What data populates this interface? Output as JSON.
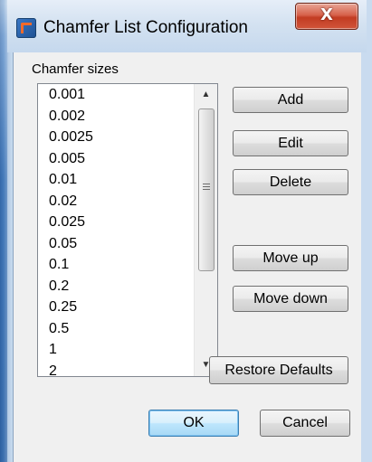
{
  "window": {
    "title": "Chamfer List Configuration",
    "close_glyph": "X"
  },
  "group": {
    "label": "Chamfer sizes"
  },
  "list": {
    "items": [
      "0.001",
      "0.002",
      "0.0025",
      "0.005",
      "0.01",
      "0.02",
      "0.025",
      "0.05",
      "0.1",
      "0.2",
      "0.25",
      "0.5",
      "1",
      "2"
    ],
    "scroll_position": 0.0
  },
  "buttons": {
    "add": "Add",
    "edit": "Edit",
    "delete": "Delete",
    "move_up": "Move up",
    "move_down": "Move down",
    "restore_defaults": "Restore Defaults",
    "ok": "OK",
    "cancel": "Cancel"
  },
  "colors": {
    "window_frame": "#c9dbef",
    "dialog_background": "#f0f0f0",
    "close_button": "#c23c22",
    "default_button_border": "#3c7fb1"
  },
  "icons": {
    "app": "autocad-app-icon",
    "close": "close-icon",
    "scroll_up": "scroll-up-arrow-icon",
    "scroll_down": "scroll-down-arrow-icon"
  }
}
